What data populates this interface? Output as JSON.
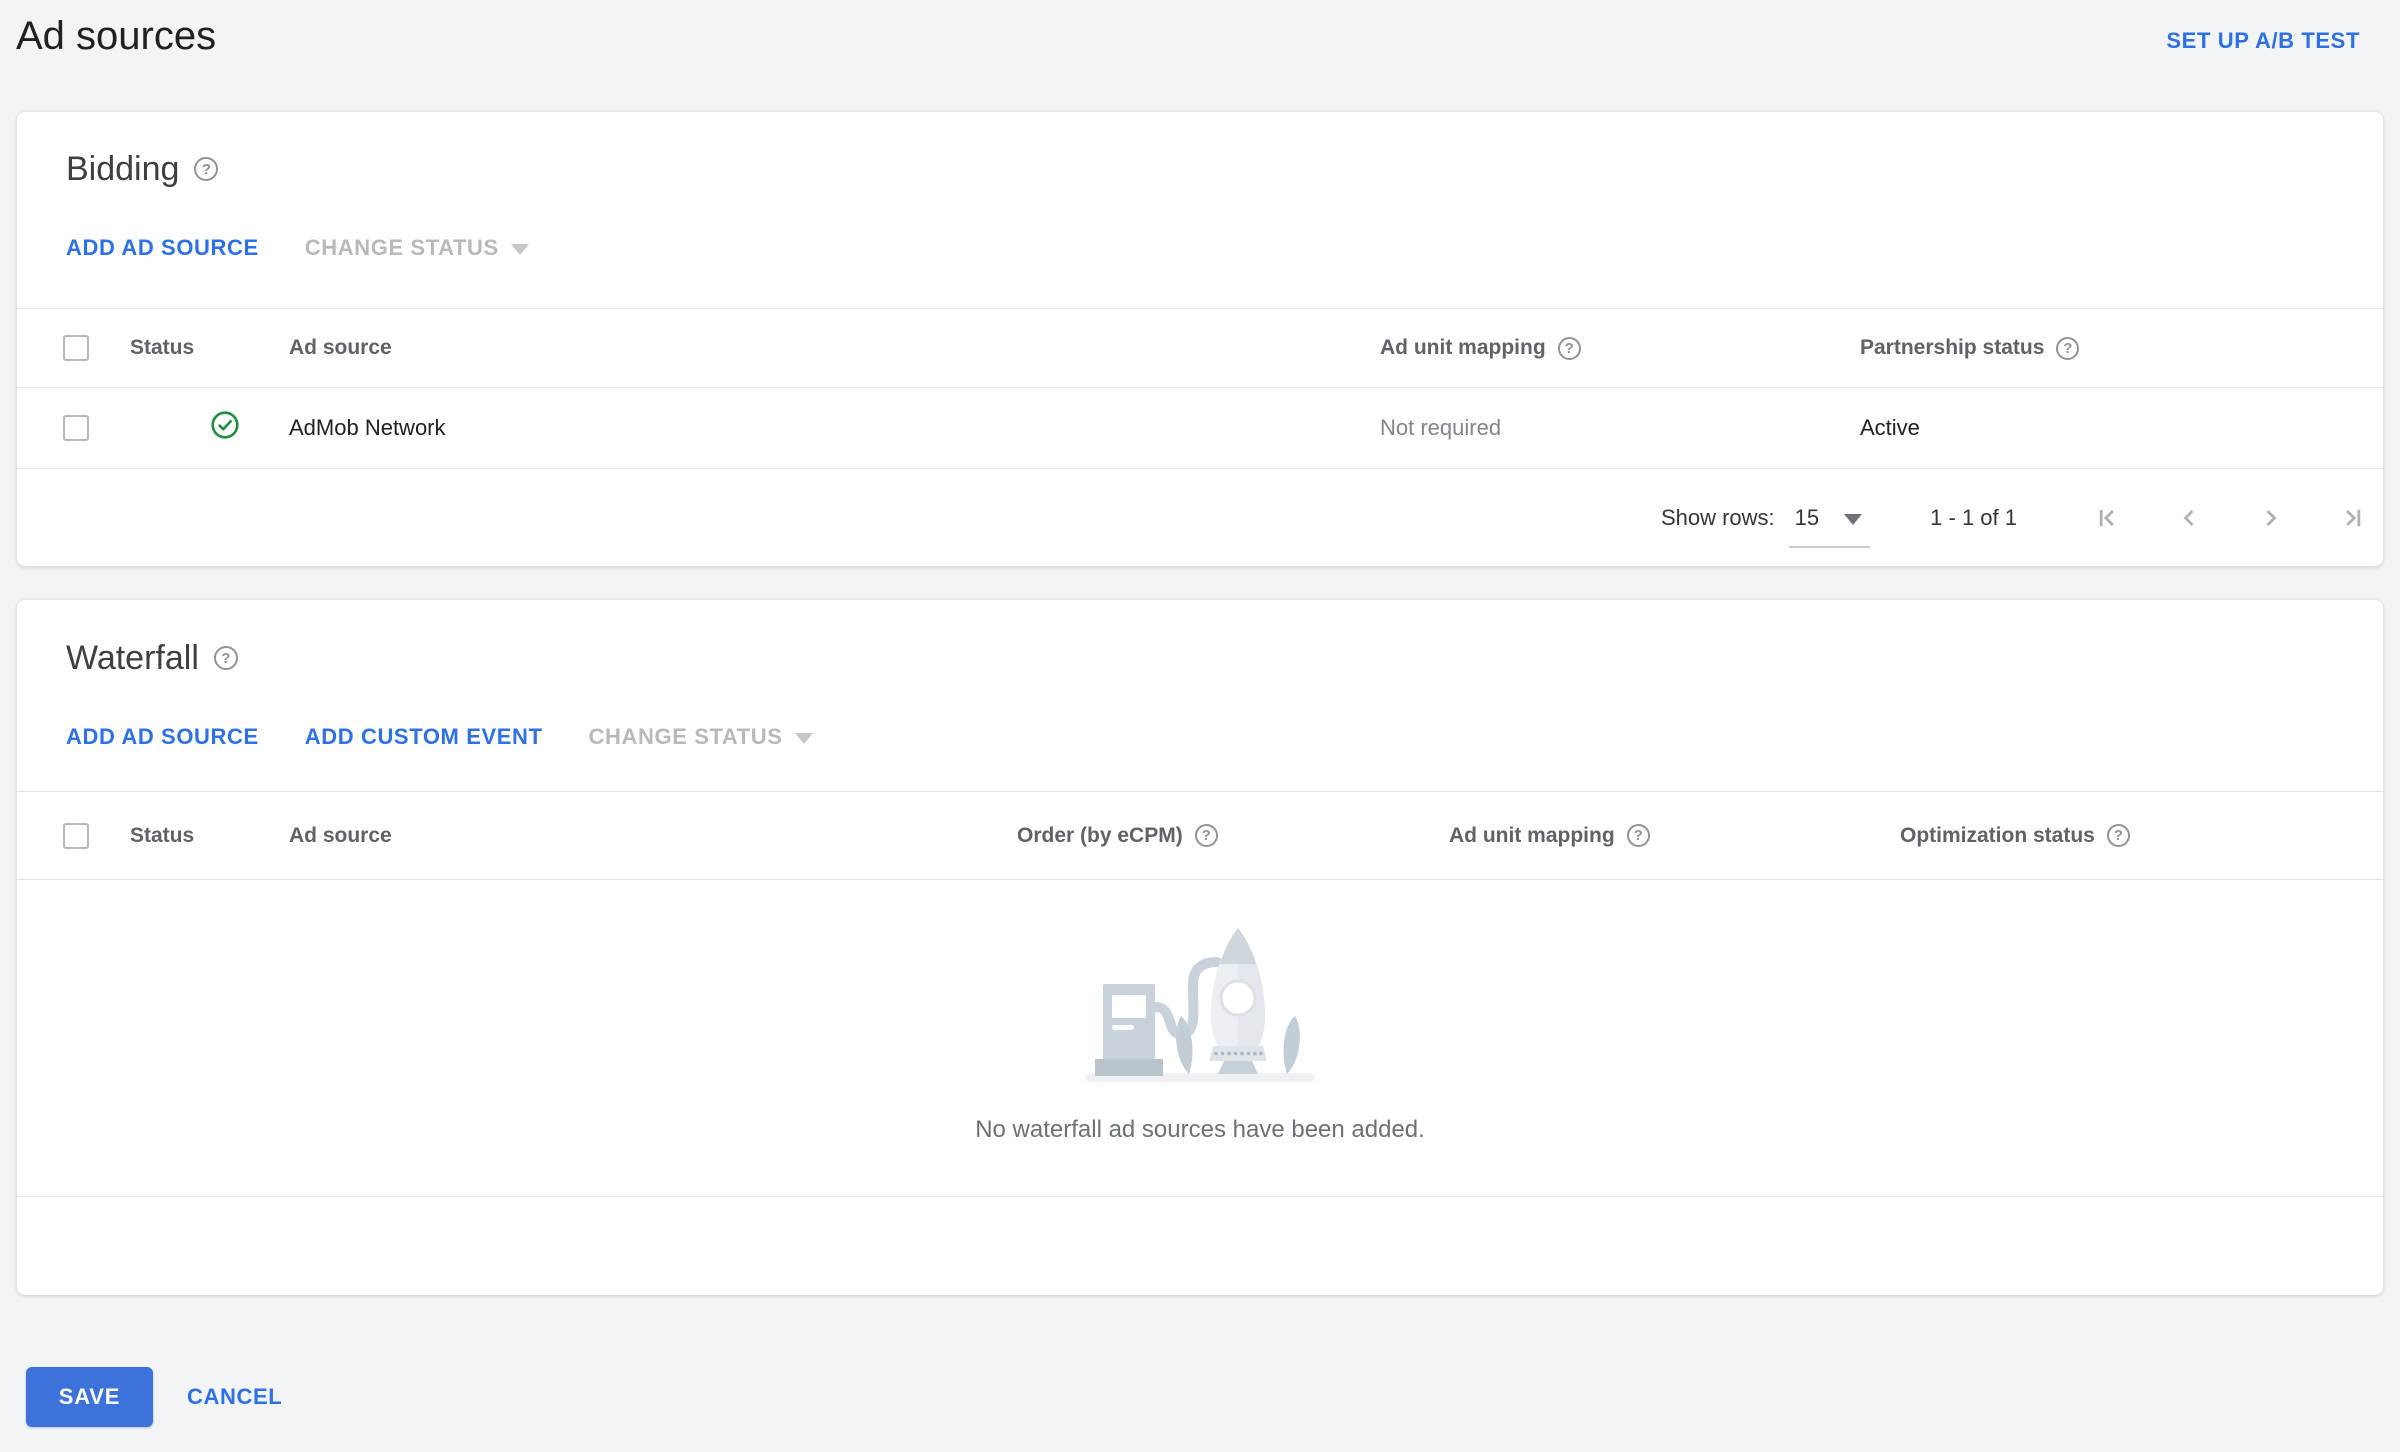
{
  "page": {
    "title": "Ad sources",
    "setup_ab_test": "SET UP A/B TEST"
  },
  "bidding": {
    "title": "Bidding",
    "actions": {
      "add_ad_source": "ADD AD SOURCE",
      "change_status": "CHANGE STATUS"
    },
    "table": {
      "headers": [
        "Status",
        "Ad source",
        "Ad unit mapping",
        "Partnership status"
      ],
      "rows": [
        {
          "status_icon": "green-check-circle",
          "ad_source": "AdMob Network",
          "ad_unit_mapping": "Not required",
          "partnership_status": "Active"
        }
      ]
    },
    "pagination": {
      "show_rows_label": "Show rows:",
      "rows_per_page": "15",
      "range": "1 - 1 of 1",
      "nav_icons": [
        "first-page-icon",
        "previous-page-icon",
        "next-page-icon",
        "last-page-icon"
      ]
    }
  },
  "waterfall": {
    "title": "Waterfall",
    "actions": {
      "add_ad_source": "ADD AD SOURCE",
      "add_custom_event": "ADD CUSTOM EVENT",
      "change_status": "CHANGE STATUS"
    },
    "table": {
      "headers": [
        "Status",
        "Ad source",
        "Order (by eCPM)",
        "Ad unit mapping",
        "Optimization status"
      ]
    },
    "empty_state": {
      "illustration": "rocket-and-fuel-pump",
      "message": "No waterfall ad sources have been added."
    }
  },
  "footer": {
    "save": "SAVE",
    "cancel": "CANCEL"
  },
  "colors": {
    "link_blue": "#2e70e6",
    "button_blue": "#3c72da",
    "success_green": "#1e8e3e",
    "disabled_gray": "#b6b9be",
    "page_background": "#f3f4f6"
  }
}
